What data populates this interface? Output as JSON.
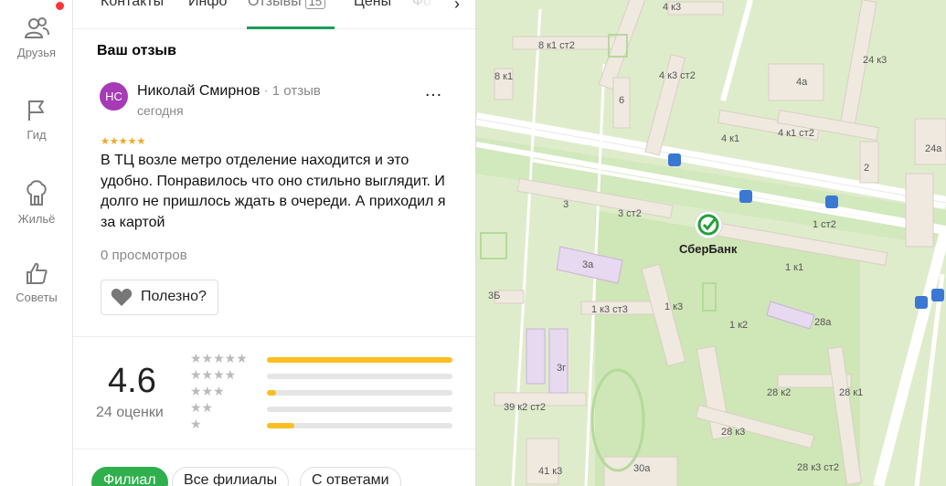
{
  "rail": {
    "items": [
      {
        "label": "Друзья",
        "icon": "friends-icon"
      },
      {
        "label": "Гид",
        "icon": "flag-icon"
      },
      {
        "label": "Жильё",
        "icon": "housing-icon"
      },
      {
        "label": "Советы",
        "icon": "thumbs-up-icon"
      }
    ],
    "notification_dot_color": "#ff3333"
  },
  "tabs": {
    "items": [
      "Контакты",
      "Инфо",
      "Отзывы",
      "Цены",
      "Фо"
    ],
    "active": "Отзывы",
    "reviews_count": "15",
    "accent": "#1b9c5b"
  },
  "my_review": {
    "section_title": "Ваш отзыв",
    "avatar_initials": "НС",
    "avatar_color": "#a63bb5",
    "author": "Николай Смирнов",
    "author_reviews": "1 отзыв",
    "date": "сегодня",
    "stars": "★★★★★",
    "rating": 5,
    "text": "В ТЦ возле метро отделение находится и это удобно. Понравилось что оно стильно выглядит. И долго не пришлось ждать в очереди. А приходил я за картой",
    "views": "0 просмотров",
    "helpful_label": "Полезно?"
  },
  "summary": {
    "rating": "4.6",
    "ratings_count": "24 оценки",
    "distribution": [
      {
        "stars": "★★★★★",
        "fraction": 1.0
      },
      {
        "stars": "★★★★",
        "fraction": 0.0
      },
      {
        "stars": "★★★",
        "fraction": 0.05
      },
      {
        "stars": "★★",
        "fraction": 0.0
      },
      {
        "stars": "★",
        "fraction": 0.15
      }
    ],
    "bar_color": "#fbbf24"
  },
  "filters": {
    "items": [
      "Филиал",
      "Все филиалы",
      "С ответами"
    ],
    "active": "Филиал"
  },
  "map": {
    "poi": {
      "name": "СберБанк",
      "icon": "sberbank-logo-icon"
    },
    "labels": [
      "4 к3",
      "8 к1 ст2",
      "8 к1",
      "4 к3 ст2",
      "24 к3",
      "4а",
      "6",
      "4 к1",
      "4 к1 ст2",
      "24а",
      "2",
      "3",
      "3 ст2",
      "1 ст2",
      "1 к1",
      "3а",
      "3Б",
      "1 к3 ст3",
      "1 к3",
      "1 к2",
      "28а",
      "3г",
      "39 к2 ст2",
      "28 к2",
      "28 к1",
      "28 к3",
      "41 к3",
      "30а",
      "28 к3 ст2"
    ],
    "transit_icon": "bus-stop-icon"
  }
}
